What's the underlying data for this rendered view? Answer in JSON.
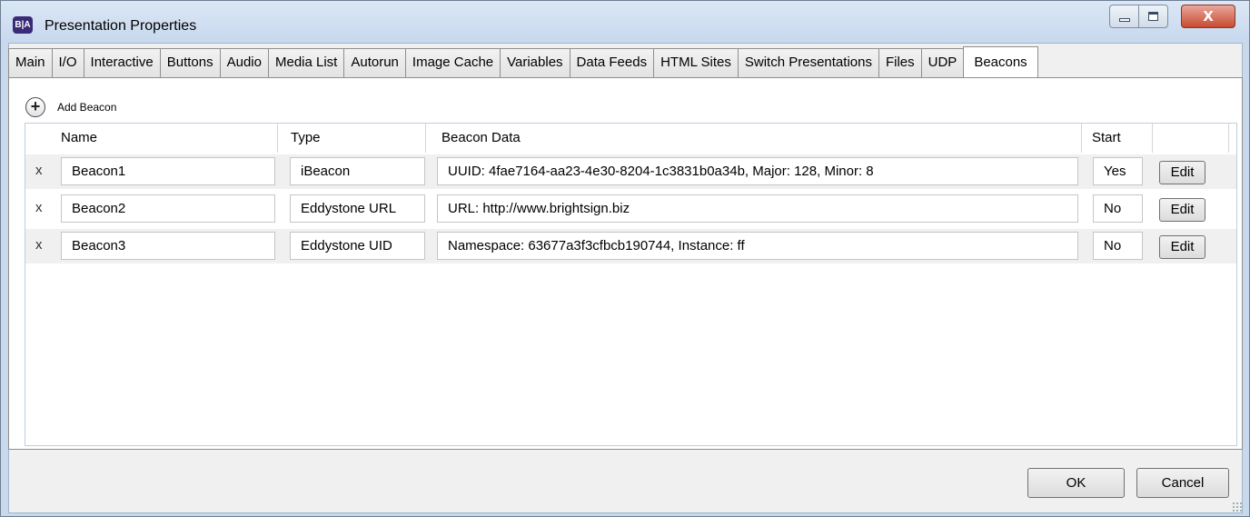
{
  "window": {
    "icon_text": "B|A",
    "title": "Presentation Properties",
    "close_glyph": "X"
  },
  "tabs": [
    {
      "label": "Main"
    },
    {
      "label": "I/O"
    },
    {
      "label": "Interactive"
    },
    {
      "label": "Buttons"
    },
    {
      "label": "Audio"
    },
    {
      "label": "Media List"
    },
    {
      "label": "Autorun"
    },
    {
      "label": "Image Cache"
    },
    {
      "label": "Variables"
    },
    {
      "label": "Data Feeds"
    },
    {
      "label": "HTML Sites"
    },
    {
      "label": "Switch Presentations"
    },
    {
      "label": "Files"
    },
    {
      "label": "UDP"
    },
    {
      "label": "Beacons",
      "active": true
    }
  ],
  "toolbar": {
    "add_icon": "+",
    "add_label": "Add Beacon"
  },
  "grid": {
    "columns": [
      "Name",
      "Type",
      "Beacon Data",
      "Start"
    ],
    "delete_glyph": "x",
    "edit_label": "Edit",
    "rows": [
      {
        "name": "Beacon1",
        "type": "iBeacon",
        "data": "UUID: 4fae7164-aa23-4e30-8204-1c3831b0a34b, Major: 128, Minor: 8",
        "start": "Yes"
      },
      {
        "name": "Beacon2",
        "type": "Eddystone URL",
        "data": "URL: http://www.brightsign.biz",
        "start": "No"
      },
      {
        "name": "Beacon3",
        "type": "Eddystone UID",
        "data": "Namespace: 63677a3f3cfbcb190744, Instance: ff",
        "start": "No"
      }
    ]
  },
  "footer": {
    "ok_label": "OK",
    "cancel_label": "Cancel"
  }
}
